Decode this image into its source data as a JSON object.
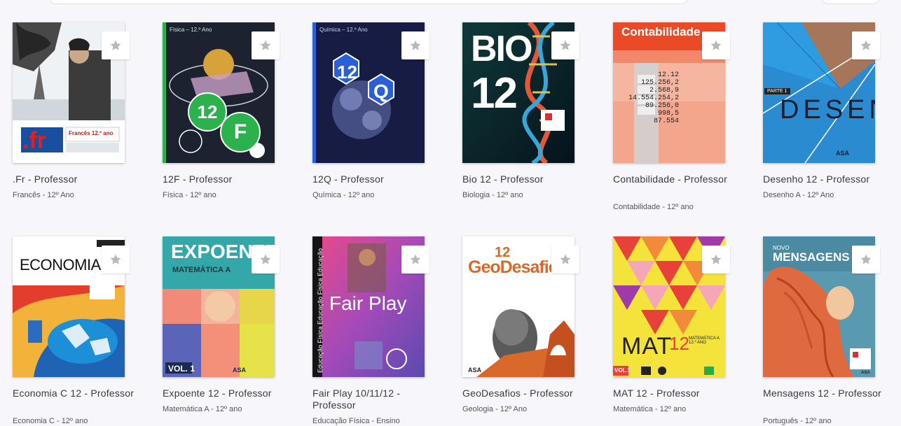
{
  "books": [
    {
      "title": ".Fr - Professor",
      "subtitle": "Francês - 12º Ano",
      "cover_text": ".fr",
      "cover_badge": "Francês 12.º ano"
    },
    {
      "title": "12F - Professor",
      "subtitle": "Física - 12º ano",
      "cover_text": "Física – 12.º Ano",
      "cover_badge_a": "12",
      "cover_badge_b": "F"
    },
    {
      "title": "12Q - Professor",
      "subtitle": "Química - 12º ano",
      "cover_text": "Química – 12.º Ano",
      "cover_badge_a": "12",
      "cover_badge_b": "Q"
    },
    {
      "title": "Bio 12 - Professor",
      "subtitle": "Biologia - 12º ano",
      "cover_text_a": "BIO",
      "cover_text_b": "12"
    },
    {
      "title": "Contabilidade - Professor",
      "subtitle": "Contabilidade - 12º ano",
      "cover_text": "Contabilidade",
      "cover_numbers": [
        "12.12",
        "125.256,2",
        "2.568,9",
        "14.554.254,2",
        "89.256,0",
        "998,5",
        "87.554"
      ]
    },
    {
      "title": "Desenho 12 - Professor",
      "subtitle": "Desenho A - 12º Ano",
      "cover_text": "DESENH",
      "cover_tag": "PARTE 1",
      "cover_brand": "ASA"
    },
    {
      "title": "Economia C 12 - Professor",
      "subtitle": "Economia C - 12º ano",
      "cover_text": "ECONOMIA"
    },
    {
      "title": "Expoente 12 - Professor",
      "subtitle": "Matemática A - 12º ano",
      "cover_text": "EXPOENTE",
      "cover_sub": "MATEMÁTICA A",
      "cover_vol": "VOL. 1",
      "cover_brand": "ASA"
    },
    {
      "title": "Fair Play 10/11/12 - Professor",
      "subtitle": "Educação Física - Ensino",
      "cover_text": "Fair Play",
      "cover_side": "Educação Física Educação Física Educação"
    },
    {
      "title": "GeoDesafios - Professor",
      "subtitle": "Geologia - 12º Ano",
      "cover_text_a": "12",
      "cover_text_b": "GeoDesafio",
      "cover_brand": "ASA"
    },
    {
      "title": "MAT 12 - Professor",
      "subtitle": "Matemática - 12º ano",
      "cover_text_a": "MAT",
      "cover_text_b": "12",
      "cover_side": "MATEMÁTICA A 12.º ANO",
      "cover_vol": "VOL.1"
    },
    {
      "title": "Mensagens 12 - Professor",
      "subtitle": "Português - 12º ano",
      "cover_text_a": "NOVO",
      "cover_text_b": "MENSAGENS",
      "cover_brand": "ASA"
    }
  ],
  "colors": {
    "fav_star": "#b8b8b8",
    "background": "#f7f7fb"
  }
}
